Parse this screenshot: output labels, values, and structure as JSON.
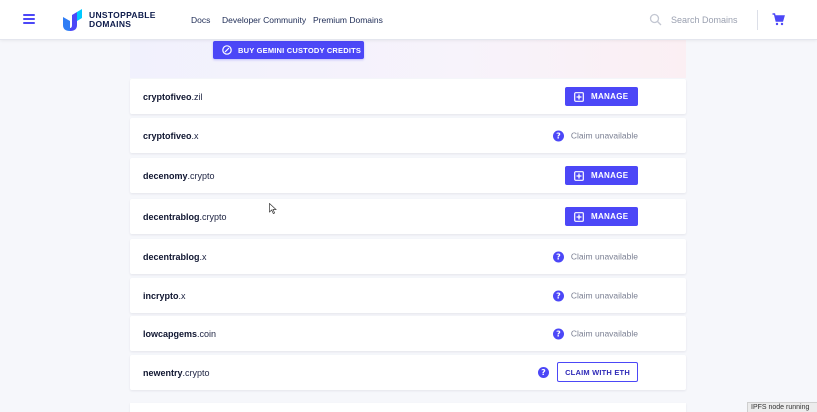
{
  "header": {
    "logo_text_line1": "UNSTOPPABLE",
    "logo_text_line2": "DOMAINS",
    "nav": [
      "Docs",
      "Developer Community",
      "Premium Domains"
    ],
    "search_placeholder": "Search Domains",
    "icons": [
      "menu-icon",
      "search-icon",
      "cart-icon"
    ]
  },
  "colors": {
    "accent": "#4c47f7",
    "text": "#1b2140",
    "muted": "#7a7f92"
  },
  "gemini_button": "BUY GEMINI CUSTODY CREDITS",
  "labels": {
    "manage": "MANAGE",
    "claim_unavailable": "Claim unavailable",
    "claim_with_eth": "CLAIM WITH ETH"
  },
  "domains": [
    {
      "name": "cryptofiveo",
      "tld": ".zil",
      "action": "manage"
    },
    {
      "name": "cryptofiveo",
      "tld": ".x",
      "action": "unavailable"
    },
    {
      "name": "decenomy",
      "tld": ".crypto",
      "action": "manage"
    },
    {
      "name": "decentrablog",
      "tld": ".crypto",
      "action": "manage"
    },
    {
      "name": "decentrablog",
      "tld": ".x",
      "action": "unavailable"
    },
    {
      "name": "incrypto",
      "tld": ".x",
      "action": "unavailable"
    },
    {
      "name": "lowcapgems",
      "tld": ".coin",
      "action": "unavailable"
    },
    {
      "name": "newentry",
      "tld": ".crypto",
      "action": "claim"
    }
  ],
  "toast": "IPFS node running"
}
